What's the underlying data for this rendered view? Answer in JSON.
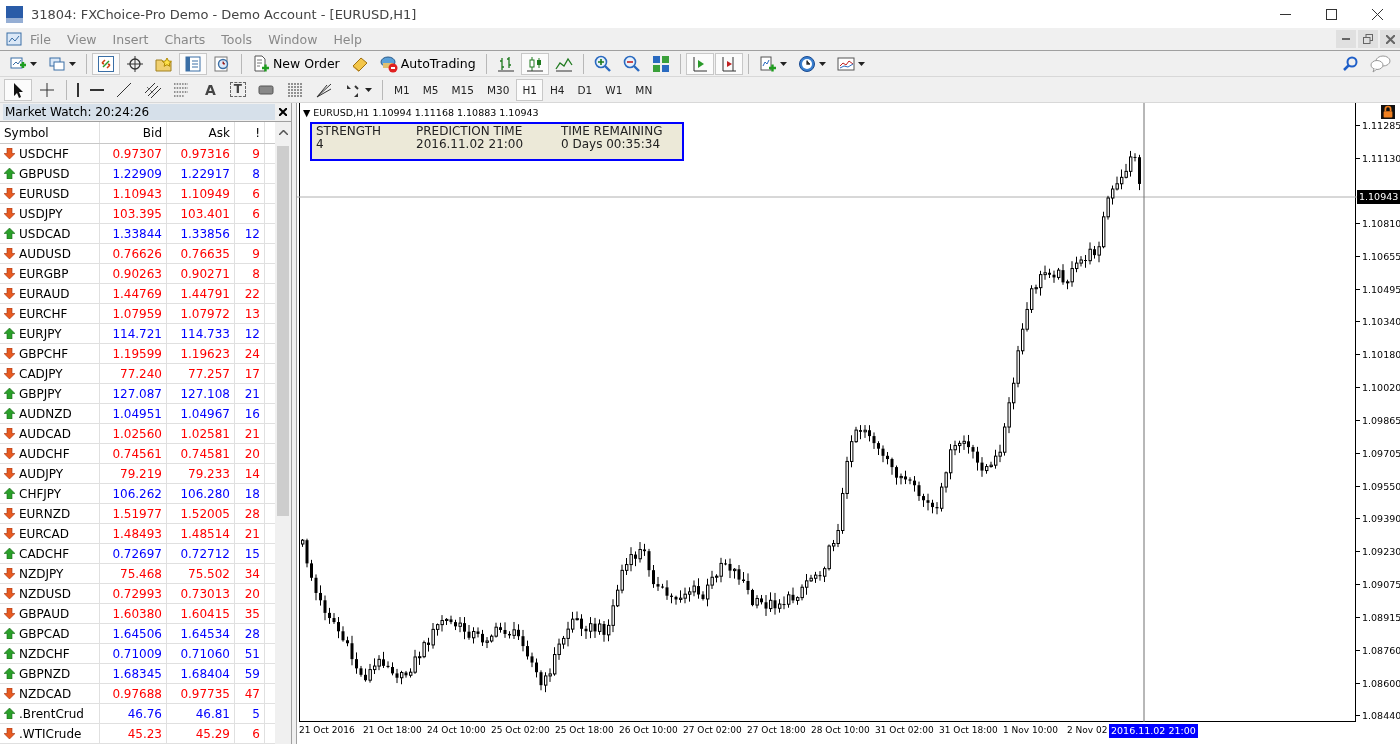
{
  "window": {
    "title": "31804: FXChoice-Pro Demo - Demo Account - [EURUSD,H1]"
  },
  "menu": [
    "File",
    "View",
    "Insert",
    "Charts",
    "Tools",
    "Window",
    "Help"
  ],
  "toolbar": [
    {
      "kind": "new-chart",
      "pressed": false
    },
    {
      "kind": "profiles",
      "pressed": false
    },
    {
      "kind": "sep"
    },
    {
      "kind": "market-watch",
      "pressed": true
    },
    {
      "kind": "data-window",
      "pressed": false
    },
    {
      "kind": "navigator",
      "pressed": false
    },
    {
      "kind": "terminal",
      "pressed": true
    },
    {
      "kind": "tester",
      "pressed": false
    },
    {
      "kind": "sep"
    },
    {
      "kind": "new-order",
      "label": "New Order",
      "pressed": false
    },
    {
      "kind": "editor",
      "pressed": false
    },
    {
      "kind": "autotrading",
      "label": "AutoTrading",
      "pressed": false
    },
    {
      "kind": "sep"
    },
    {
      "kind": "bar-chart",
      "pressed": false
    },
    {
      "kind": "candles",
      "pressed": true
    },
    {
      "kind": "line-chart",
      "pressed": false
    },
    {
      "kind": "sep"
    },
    {
      "kind": "zoom-in",
      "pressed": false
    },
    {
      "kind": "zoom-out",
      "pressed": false
    },
    {
      "kind": "tile",
      "pressed": false
    },
    {
      "kind": "sep"
    },
    {
      "kind": "chart-shift",
      "pressed": true
    },
    {
      "kind": "auto-scroll",
      "pressed": true
    },
    {
      "kind": "sep"
    },
    {
      "kind": "indicators",
      "pressed": false
    },
    {
      "kind": "periods",
      "pressed": false
    },
    {
      "kind": "templates",
      "pressed": false
    }
  ],
  "drawing_toolbar": [
    {
      "kind": "cursor",
      "pressed": true
    },
    {
      "kind": "crosshair",
      "pressed": false
    },
    {
      "kind": "sep"
    },
    {
      "kind": "vline",
      "pressed": false
    },
    {
      "kind": "hline",
      "pressed": false
    },
    {
      "kind": "trendline",
      "pressed": false
    },
    {
      "kind": "channel",
      "pressed": false
    },
    {
      "kind": "fibo",
      "pressed": false
    },
    {
      "kind": "text",
      "label": "A",
      "pressed": false
    },
    {
      "kind": "text-label",
      "label": "T",
      "pressed": false
    },
    {
      "kind": "rectangle",
      "pressed": false
    },
    {
      "kind": "gann",
      "pressed": false
    },
    {
      "kind": "fan",
      "pressed": false
    },
    {
      "kind": "arrows",
      "pressed": false
    },
    {
      "kind": "sep"
    }
  ],
  "timeframes": [
    {
      "label": "M1",
      "selected": false
    },
    {
      "label": "M5",
      "selected": false
    },
    {
      "label": "M15",
      "selected": false
    },
    {
      "label": "M30",
      "selected": false
    },
    {
      "label": "H1",
      "selected": true
    },
    {
      "label": "H4",
      "selected": false
    },
    {
      "label": "D1",
      "selected": false
    },
    {
      "label": "W1",
      "selected": false
    },
    {
      "label": "MN",
      "selected": false
    }
  ],
  "market_watch": {
    "title": "Market Watch: 20:24:26",
    "columns": [
      "Symbol",
      "Bid",
      "Ask",
      "!"
    ],
    "rows": [
      {
        "symbol": "USDCHF",
        "bid": "0.97307",
        "ask": "0.97316",
        "spread": "9",
        "kind": "down"
      },
      {
        "symbol": "GBPUSD",
        "bid": "1.22909",
        "ask": "1.22917",
        "spread": "8",
        "kind": "up"
      },
      {
        "symbol": "EURUSD",
        "bid": "1.10943",
        "ask": "1.10949",
        "spread": "6",
        "kind": "down"
      },
      {
        "symbol": "USDJPY",
        "bid": "103.395",
        "ask": "103.401",
        "spread": "6",
        "kind": "down"
      },
      {
        "symbol": "USDCAD",
        "bid": "1.33844",
        "ask": "1.33856",
        "spread": "12",
        "kind": "up"
      },
      {
        "symbol": "AUDUSD",
        "bid": "0.76626",
        "ask": "0.76635",
        "spread": "9",
        "kind": "down"
      },
      {
        "symbol": "EURGBP",
        "bid": "0.90263",
        "ask": "0.90271",
        "spread": "8",
        "kind": "down"
      },
      {
        "symbol": "EURAUD",
        "bid": "1.44769",
        "ask": "1.44791",
        "spread": "22",
        "kind": "down"
      },
      {
        "symbol": "EURCHF",
        "bid": "1.07959",
        "ask": "1.07972",
        "spread": "13",
        "kind": "down"
      },
      {
        "symbol": "EURJPY",
        "bid": "114.721",
        "ask": "114.733",
        "spread": "12",
        "kind": "up"
      },
      {
        "symbol": "GBPCHF",
        "bid": "1.19599",
        "ask": "1.19623",
        "spread": "24",
        "kind": "down"
      },
      {
        "symbol": "CADJPY",
        "bid": "77.240",
        "ask": "77.257",
        "spread": "17",
        "kind": "down"
      },
      {
        "symbol": "GBPJPY",
        "bid": "127.087",
        "ask": "127.108",
        "spread": "21",
        "kind": "up"
      },
      {
        "symbol": "AUDNZD",
        "bid": "1.04951",
        "ask": "1.04967",
        "spread": "16",
        "kind": "up"
      },
      {
        "symbol": "AUDCAD",
        "bid": "1.02560",
        "ask": "1.02581",
        "spread": "21",
        "kind": "down"
      },
      {
        "symbol": "AUDCHF",
        "bid": "0.74561",
        "ask": "0.74581",
        "spread": "20",
        "kind": "down"
      },
      {
        "symbol": "AUDJPY",
        "bid": "79.219",
        "ask": "79.233",
        "spread": "14",
        "kind": "down"
      },
      {
        "symbol": "CHFJPY",
        "bid": "106.262",
        "ask": "106.280",
        "spread": "18",
        "kind": "up"
      },
      {
        "symbol": "EURNZD",
        "bid": "1.51977",
        "ask": "1.52005",
        "spread": "28",
        "kind": "down"
      },
      {
        "symbol": "EURCAD",
        "bid": "1.48493",
        "ask": "1.48514",
        "spread": "21",
        "kind": "down"
      },
      {
        "symbol": "CADCHF",
        "bid": "0.72697",
        "ask": "0.72712",
        "spread": "15",
        "kind": "up"
      },
      {
        "symbol": "NZDJPY",
        "bid": "75.468",
        "ask": "75.502",
        "spread": "34",
        "kind": "down"
      },
      {
        "symbol": "NZDUSD",
        "bid": "0.72993",
        "ask": "0.73013",
        "spread": "20",
        "kind": "down"
      },
      {
        "symbol": "GBPAUD",
        "bid": "1.60380",
        "ask": "1.60415",
        "spread": "35",
        "kind": "down"
      },
      {
        "symbol": "GBPCAD",
        "bid": "1.64506",
        "ask": "1.64534",
        "spread": "28",
        "kind": "up"
      },
      {
        "symbol": "NZDCHF",
        "bid": "0.71009",
        "ask": "0.71060",
        "spread": "51",
        "kind": "up"
      },
      {
        "symbol": "GBPNZD",
        "bid": "1.68345",
        "ask": "1.68404",
        "spread": "59",
        "kind": "up"
      },
      {
        "symbol": "NZDCAD",
        "bid": "0.97688",
        "ask": "0.97735",
        "spread": "47",
        "kind": "down"
      },
      {
        "symbol": ".BrentCrud",
        "bid": "46.76",
        "ask": "46.81",
        "spread": "5",
        "kind": "up"
      },
      {
        "symbol": ".WTICrude",
        "bid": "45.23",
        "ask": "45.29",
        "spread": "6",
        "kind": "down"
      }
    ]
  },
  "chart": {
    "header_marker": "▼",
    "symbol": "EURUSD,H1",
    "ohlc": "1.10994 1.11168 1.10883 1.10943",
    "info_panel": {
      "columns": [
        {
          "heading": "STRENGTH",
          "value": "4"
        },
        {
          "heading": "PREDICTION TIME",
          "value": "2016.11.02 21:00"
        },
        {
          "heading": "TIME REMAINING",
          "value": "0 Days 00:35:34"
        }
      ]
    },
    "price_axis_upper": [
      "1.11285",
      "1.11130"
    ],
    "price_axis": [
      "1.10810",
      "1.10655",
      "1.10495",
      "1.10340",
      "1.10180",
      "1.10020",
      "1.09865",
      "1.09705",
      "1.09550",
      "1.09390",
      "1.09230",
      "1.09075",
      "1.08915",
      "1.08760",
      "1.08600",
      "1.08440"
    ],
    "current_price": "1.10943",
    "time_axis": [
      "21 Oct 2016",
      "21 Oct 18:00",
      "24 Oct 10:00",
      "25 Oct 02:00",
      "25 Oct 18:00",
      "26 Oct 10:00",
      "27 Oct 02:00",
      "27 Oct 18:00",
      "28 Oct 10:00",
      "31 Oct 02:00",
      "31 Oct 18:00",
      "1 Nov 10:00",
      "2 Nov 02"
    ],
    "cursor_time": "2016.11.02 21:00"
  }
}
